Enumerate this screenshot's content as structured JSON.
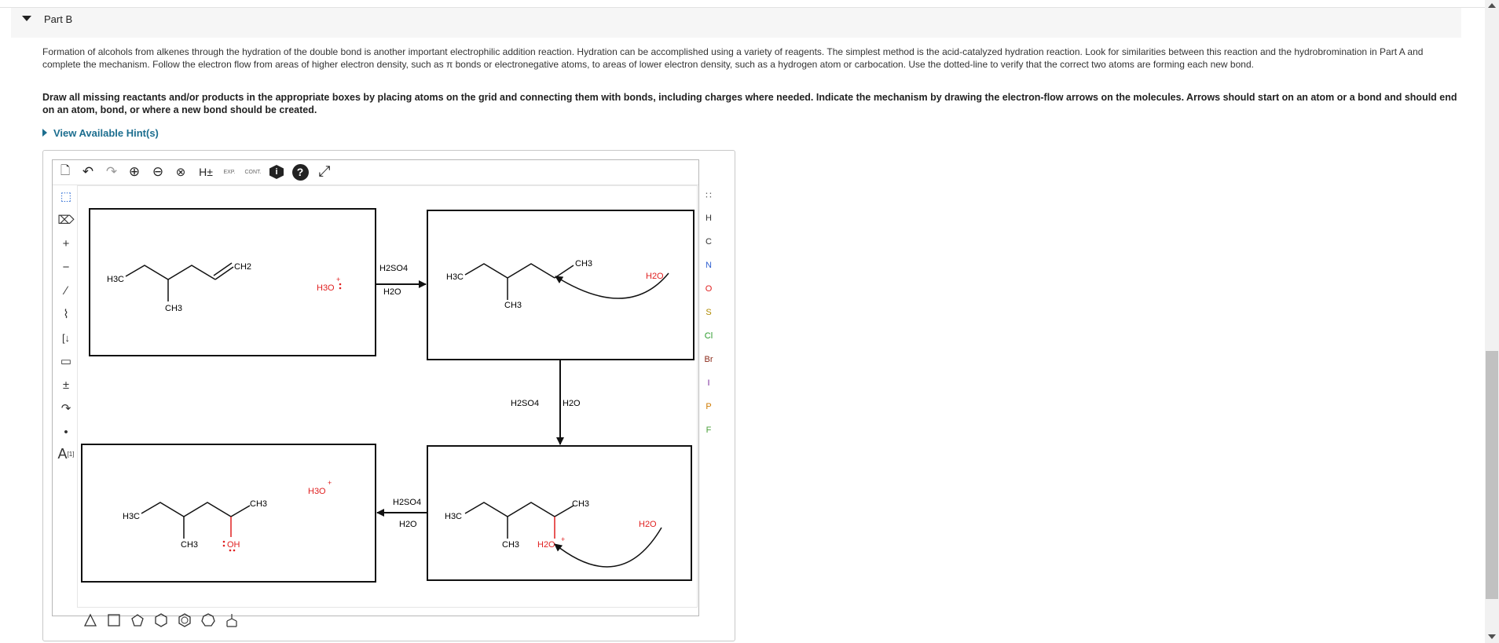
{
  "part": {
    "title": "Part B"
  },
  "instructions": {
    "paragraph1": "Formation of alcohols from alkenes through the hydration of the double bond is another important electrophilic addition reaction. Hydration can be accomplished using a variety of reagents. The simplest method is the acid-catalyzed hydration reaction. Look for similarities between this reaction and the hydrobromination in Part A and complete the mechanism. Follow the electron flow from areas of higher electron density, such as π bonds or electronegative atoms, to areas of lower electron density, such as a hydrogen atom or carbocation. Use the dotted-line to verify that the correct two atoms are forming each new bond.",
    "paragraph2": "Draw all missing reactants and/or products in the appropriate boxes by placing atoms on the grid and connecting them with bonds, including charges where needed. Indicate the mechanism by drawing the electron-flow arrows on the molecules. Arrows should start on an atom or a bond and should end on an atom, bond, or where a new bond should be created."
  },
  "hint": {
    "label": "View Available Hint(s)"
  },
  "toolbar": {
    "new": "🗋",
    "undo": "↶",
    "redo": "↷",
    "zoom_in": "⊕",
    "zoom_out": "⊖",
    "clear": "⊗",
    "h_label": "H±",
    "exp_label": "EXP.",
    "cont_label": "CONT.",
    "info": "i",
    "help": "?",
    "fullscreen": "⤢"
  },
  "left_tools": {
    "select": "⬚",
    "erase": "⌦",
    "plus": "+",
    "minus": "−",
    "single_bond": "∕",
    "chain": "⌇",
    "bracket": "[↓",
    "rectangle": "▭",
    "charge": "±",
    "arrow": "↷",
    "dot": "•",
    "text_sup": "[1]",
    "text": "A"
  },
  "atoms": {
    "periodic": "∷",
    "list": [
      {
        "symbol": "H",
        "color": "#333333"
      },
      {
        "symbol": "C",
        "color": "#333333"
      },
      {
        "symbol": "N",
        "color": "#2f5fd0"
      },
      {
        "symbol": "O",
        "color": "#e02020"
      },
      {
        "symbol": "S",
        "color": "#b08a00"
      },
      {
        "symbol": "Cl",
        "color": "#2a9a2a"
      },
      {
        "symbol": "Br",
        "color": "#8b2a1a"
      },
      {
        "symbol": "I",
        "color": "#7a2a9a"
      },
      {
        "symbol": "P",
        "color": "#d07a00"
      },
      {
        "symbol": "F",
        "color": "#4aa03a"
      }
    ]
  },
  "reaction": {
    "box1": {
      "h3c": "H3C",
      "ch3": "CH3",
      "ch2": "CH2",
      "h3o": "H3O"
    },
    "box2": {
      "h3c": "H3C",
      "ch3_side": "CH3",
      "ch3_top": "CH3",
      "h2o": "H2O"
    },
    "box3": {
      "h3c": "H3C",
      "ch3_side": "CH3",
      "ch3_top": "CH3",
      "h2o_sub": "H2O",
      "h2o": "H2O"
    },
    "box4": {
      "h3c": "H3C",
      "ch3_side": "CH3",
      "ch3_top": "CH3",
      "oh": "OH",
      "h3o": "H3O"
    },
    "conditions": {
      "arrow1_top": "H2SO4",
      "arrow1_bottom": "H2O",
      "arrow2_left": "H2SO4",
      "arrow2_right": "H2O",
      "arrow3_top": "H2SO4",
      "arrow3_bottom": "H2O"
    }
  },
  "ring_templates": [
    "triangle",
    "square",
    "pentagon",
    "hexagon",
    "benzene",
    "heptagon",
    "cyclohexane"
  ],
  "colors": {
    "accent": "#1c6e8f",
    "red": "#e02020"
  }
}
